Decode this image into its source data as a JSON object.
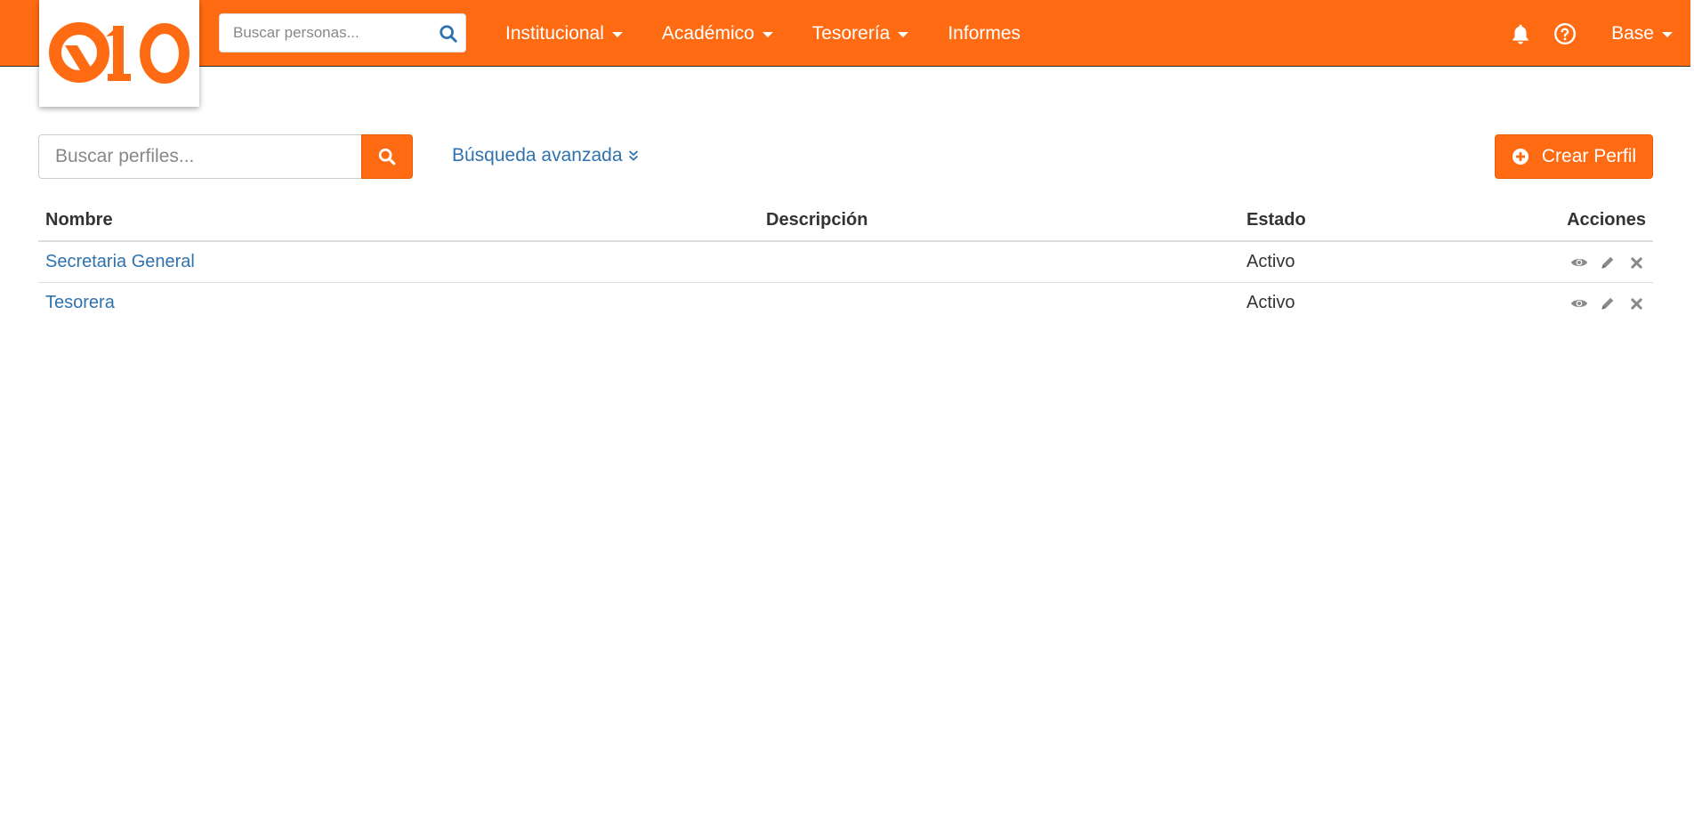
{
  "colors": {
    "brand": "#ff6b12",
    "link": "#2f72ad",
    "action_icon": "#8a8a8a"
  },
  "header": {
    "logo_text": "Q10",
    "people_search": {
      "placeholder": "Buscar personas...",
      "icon": "search-icon"
    },
    "menu": [
      {
        "label": "Institucional",
        "dropdown": true
      },
      {
        "label": "Académico",
        "dropdown": true
      },
      {
        "label": "Tesorería",
        "dropdown": true
      },
      {
        "label": "Informes",
        "dropdown": false
      }
    ],
    "notifications_icon": "bell-icon",
    "help_icon": "question-circle-icon",
    "user_label": "Base"
  },
  "toolbar": {
    "profile_search": {
      "placeholder": "Buscar perfiles...",
      "icon": "search-icon"
    },
    "advanced_search_label": "Búsqueda avanzada",
    "create_button_label": "Crear Perfil",
    "create_icon": "plus-circle-icon"
  },
  "table": {
    "columns": [
      "Nombre",
      "Descripción",
      "Estado",
      "Acciones"
    ],
    "rows": [
      {
        "nombre": "Secretaria General",
        "descripcion": "",
        "estado": "Activo"
      },
      {
        "nombre": "Tesorera",
        "descripcion": "",
        "estado": "Activo"
      }
    ],
    "action_icons": [
      "eye-icon",
      "pencil-icon",
      "close-icon"
    ]
  }
}
